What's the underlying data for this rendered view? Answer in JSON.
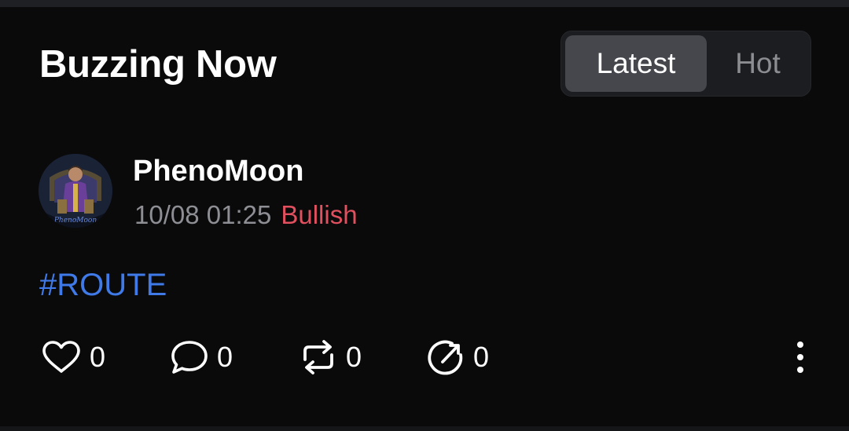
{
  "header": {
    "title": "Buzzing Now"
  },
  "tabs": [
    {
      "label": "Latest",
      "active": true
    },
    {
      "label": "Hot",
      "active": false
    }
  ],
  "post": {
    "author": "PhenoMoon",
    "avatar_logo_text": "PhenoMoon",
    "timestamp": "10/08 01:25",
    "sentiment": "Bullish",
    "hashtag": "#ROUTE",
    "actions": {
      "likes": "0",
      "comments": "0",
      "reposts": "0",
      "shares": "0"
    }
  },
  "icons": [
    "heart-icon",
    "comment-icon",
    "repost-icon",
    "share-icon",
    "more-icon"
  ],
  "colors": {
    "background": "#0a0a0b",
    "sentiment_bullish": "#e0505e",
    "hashtag": "#3f7ae8",
    "tab_active_bg": "#45474d",
    "tab_inactive_text": "#8c8d92",
    "muted_text": "#8e8f94"
  }
}
